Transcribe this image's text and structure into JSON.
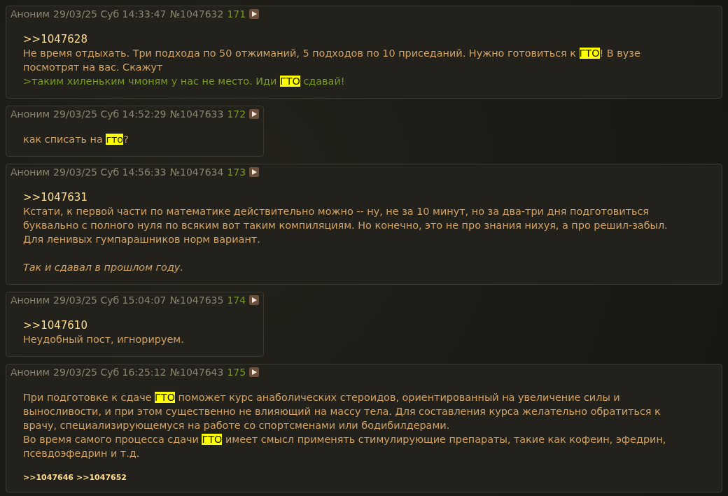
{
  "posts": [
    {
      "author": "Аноним",
      "date": "29/03/25 Суб 14:33:47",
      "number": "№1047632",
      "index": "171",
      "blocks": [
        {
          "kind": "reply",
          "segments": [
            {
              "text": ">>1047628",
              "highlight": false
            }
          ]
        },
        {
          "kind": "text",
          "segments": [
            {
              "text": "Не время отдыхать. Три подхода по 50 отжиманий, 5 подходов по 10 приседаний. Нужно готовиться к ",
              "highlight": false
            },
            {
              "text": "ГТО",
              "highlight": true
            },
            {
              "text": "! В вузе посмотрят на вас. Скажут",
              "highlight": false
            }
          ]
        },
        {
          "kind": "quote",
          "segments": [
            {
              "text": ">таким хиленьким чмоням у нас не место. Иди ",
              "highlight": false
            },
            {
              "text": "ГТО",
              "highlight": true
            },
            {
              "text": " сдавай!",
              "highlight": false
            }
          ]
        }
      ]
    },
    {
      "author": "Аноним",
      "date": "29/03/25 Суб 14:52:29",
      "number": "№1047633",
      "index": "172",
      "blocks": [
        {
          "kind": "text",
          "segments": [
            {
              "text": "как списать на ",
              "highlight": false
            },
            {
              "text": "гто",
              "highlight": true
            },
            {
              "text": "?",
              "highlight": false
            }
          ]
        }
      ]
    },
    {
      "author": "Аноним",
      "date": "29/03/25 Суб 14:56:33",
      "number": "№1047634",
      "index": "173",
      "blocks": [
        {
          "kind": "reply",
          "segments": [
            {
              "text": ">>1047631",
              "highlight": false
            }
          ]
        },
        {
          "kind": "text",
          "segments": [
            {
              "text": "Кстати, к первой части по математике действительно можно -- ну, не за 10 минут, но за два-три дня подготовиться буквально с полного нуля по всяким вот таким компиляциям. Но конечно, это не про знания нихуя, а про решил-забыл. Для ленивых гумпарашников норм вариант.",
              "highlight": false
            }
          ]
        },
        {
          "kind": "italic",
          "segments": [
            {
              "text": "Так и сдавал в прошлом году.",
              "highlight": false
            }
          ]
        }
      ]
    },
    {
      "author": "Аноним",
      "date": "29/03/25 Суб 15:04:07",
      "number": "№1047635",
      "index": "174",
      "blocks": [
        {
          "kind": "reply",
          "segments": [
            {
              "text": ">>1047610",
              "highlight": false
            }
          ]
        },
        {
          "kind": "text",
          "segments": [
            {
              "text": "Неудобный пост, игнорируем.",
              "highlight": false
            }
          ]
        }
      ]
    },
    {
      "author": "Аноним",
      "date": "29/03/25 Суб 16:25:12",
      "number": "№1047643",
      "index": "175",
      "blocks": [
        {
          "kind": "text",
          "segments": [
            {
              "text": "При подготовке к сдаче ",
              "highlight": false
            },
            {
              "text": "ГТО",
              "highlight": true
            },
            {
              "text": " поможет курс анаболических стероидов, ориентированный на увеличение силы и выносливости, и при этом существенно не влияющий на массу тела. Для составления курса желательно обратиться к врачу, специализирующемуся на работе со спортсменами или бодибилдерами.",
              "highlight": false
            }
          ]
        },
        {
          "kind": "text",
          "segments": [
            {
              "text": "Во время самого процесса сдачи ",
              "highlight": false
            },
            {
              "text": "ГТО",
              "highlight": true
            },
            {
              "text": " имеет смысл применять стимулирующие препараты, такие как кофеин, эфедрин, псевдоэфедрин и т.д.",
              "highlight": false
            }
          ]
        }
      ],
      "replies": [
        ">>1047646",
        ">>1047652"
      ]
    }
  ]
}
